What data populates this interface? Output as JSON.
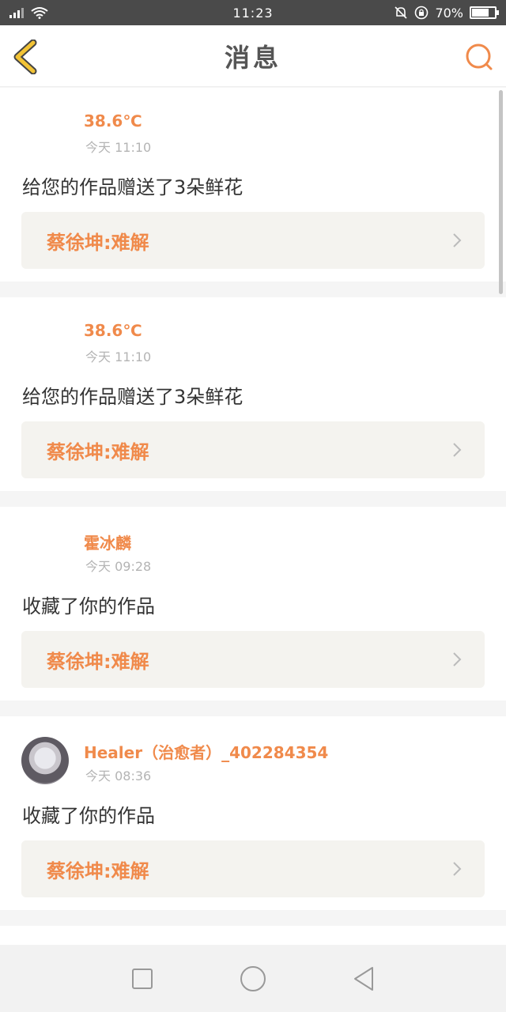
{
  "status_bar": {
    "time": "11:23",
    "battery": "70%",
    "battery_level": 0.7
  },
  "header": {
    "title": "消息",
    "back_icon": "chevron-left-icon",
    "search_icon": "search-icon"
  },
  "colors": {
    "accent": "#f08a4b",
    "back_icon": "#f2c335",
    "work_bg": "#f4f3ef"
  },
  "notifications": [
    {
      "name": "38.6℃",
      "time": "今天 11:10",
      "message": "给您的作品赠送了3朵鲜花",
      "work": "蔡徐坤:难解"
    },
    {
      "name": "38.6℃",
      "time": "今天 11:10",
      "message": "给您的作品赠送了3朵鲜花",
      "work": "蔡徐坤:难解"
    },
    {
      "name": "霍冰麟",
      "time": "今天 09:28",
      "message": "收藏了你的作品",
      "work": "蔡徐坤:难解"
    },
    {
      "name": "Healer（治愈者）_402284354",
      "time": "今天 08:36",
      "message": "收藏了你的作品",
      "work": "蔡徐坤:难解"
    }
  ]
}
